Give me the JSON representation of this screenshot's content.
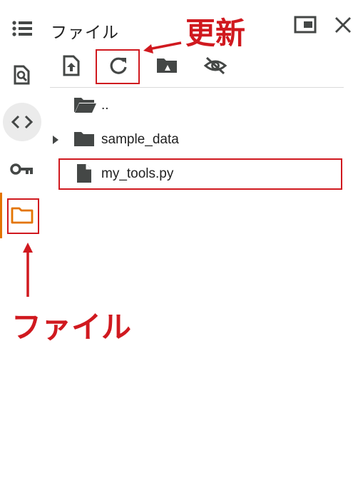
{
  "panel": {
    "title": "ファイル"
  },
  "rail": {
    "items": [
      {
        "icon": "toc-icon"
      },
      {
        "icon": "find-in-page-icon"
      },
      {
        "icon": "code-icon"
      },
      {
        "icon": "key-icon"
      },
      {
        "icon": "folder-icon",
        "active": true
      }
    ]
  },
  "toolbar": {
    "buttons": [
      {
        "icon": "upload-file-icon"
      },
      {
        "icon": "refresh-icon"
      },
      {
        "icon": "mount-drive-icon"
      },
      {
        "icon": "hide-icon"
      }
    ]
  },
  "files": [
    {
      "name": "..",
      "type": "parent-folder"
    },
    {
      "name": "sample_data",
      "type": "folder"
    },
    {
      "name": "my_tools.py",
      "type": "file"
    }
  ],
  "annotations": {
    "refresh_label": "更新",
    "files_label": "ファイル",
    "color": "#d0191f"
  },
  "colors": {
    "active_accent": "#e37400",
    "icon": "#444746"
  }
}
